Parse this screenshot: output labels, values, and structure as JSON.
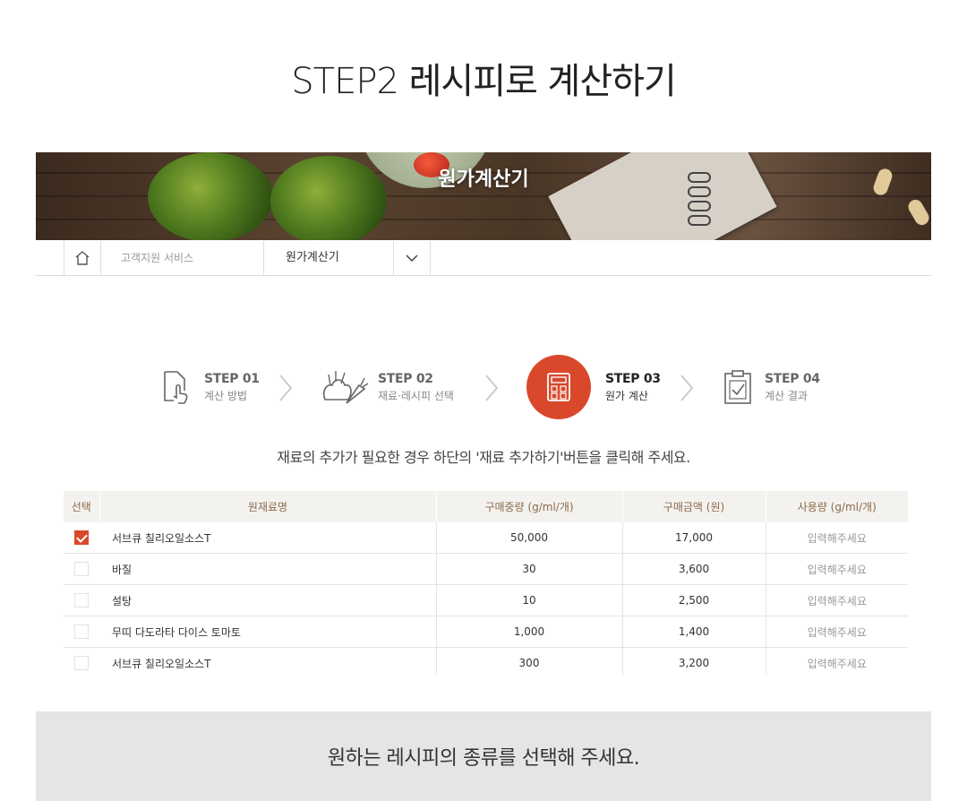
{
  "page": {
    "title": "STEP2 레시피로 계산하기"
  },
  "banner": {
    "title": "원가계산기"
  },
  "breadcrumb": {
    "home_icon": "home-icon",
    "item1": "고객지원 서비스",
    "item2": "원가계산기",
    "dropdown_icon": "chevron-down-icon"
  },
  "steps": [
    {
      "num": "STEP 01",
      "label": "계산 방법",
      "icon": "tap-document-icon"
    },
    {
      "num": "STEP 02",
      "label": "재료·레시피 선택",
      "icon": "vegetables-icon"
    },
    {
      "num": "STEP 03",
      "label": "원가 계산",
      "icon": "calculator-icon",
      "active": true
    },
    {
      "num": "STEP 04",
      "label": "계산 결과",
      "icon": "clipboard-check-icon"
    }
  ],
  "hint": "재료의 추가가 필요한 경우 하단의 '재료 추가하기'버튼을 클릭해 주세요.",
  "table": {
    "headers": [
      "선택",
      "원재료명",
      "구매중량 (g/ml/개)",
      "구매금액 (원)",
      "사용량 (g/ml/개)"
    ],
    "rows": [
      {
        "checked": true,
        "name": "서브큐 칠리오일소스T",
        "weight": "50,000",
        "price": "17,000",
        "usage": "입력해주세요"
      },
      {
        "checked": false,
        "name": "바질",
        "weight": "30",
        "price": "3,600",
        "usage": "입력해주세요"
      },
      {
        "checked": false,
        "name": "설탕",
        "weight": "10",
        "price": "2,500",
        "usage": "입력해주세요"
      },
      {
        "checked": false,
        "name": "무띠 다도라타 다이스 토마토",
        "weight": "1,000",
        "price": "1,400",
        "usage": "입력해주세요"
      },
      {
        "checked": false,
        "name": "서브큐 칠리오일소스T",
        "weight": "300",
        "price": "3,200",
        "usage": "입력해주세요"
      }
    ]
  },
  "footer": {
    "text": "원하는 레시피의 종류를 선택해 주세요."
  },
  "colors": {
    "accent": "#d9482b",
    "header_bg": "#f4f2ef",
    "footer_bg": "#e5e5e5"
  }
}
